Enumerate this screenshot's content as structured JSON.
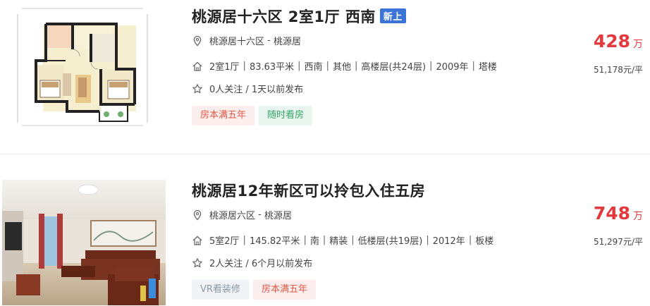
{
  "listings": [
    {
      "title": "桃源居十六区 2室1厅 西南",
      "badge": "新上",
      "community": "桃源居十六区",
      "region": "桃源居",
      "location_sep": " - ",
      "info": [
        "2室1厅",
        "83.63平米",
        "西南",
        "其他",
        "高楼层(共24层)",
        "2009年",
        "塔楼"
      ],
      "follow": "0人关注 / 1天以前发布",
      "tags": [
        "房本满五年",
        "随时看房"
      ],
      "price": "428",
      "price_unit": "万",
      "unit_price": "51,178元/平",
      "thumbnail": "floor-plan"
    },
    {
      "title": "桃源居12年新区可以拎包入住五房",
      "community": "桃源居六区",
      "region": "桃源居",
      "location_sep": " - ",
      "info": [
        "5室2厅",
        "145.82平米",
        "南",
        "精装",
        "低楼层(共19层)",
        "2012年",
        "板楼"
      ],
      "follow": "2人关注 / 6个月以前发布",
      "tags": [
        "VR看装修",
        "房本满五年"
      ],
      "price": "748",
      "price_unit": "万",
      "unit_price": "51,297元/平",
      "thumbnail": "living-room-photo"
    }
  ],
  "info_separator": "|",
  "icons": {
    "location": "map-pin-icon",
    "house": "house-icon",
    "star": "star-icon"
  },
  "colors": {
    "price": "#e4393c",
    "badge_new": "#3b74d6",
    "tag_red_text": "#e4584a",
    "tag_green_text": "#36a467",
    "tag_gray_text": "#8a98a8"
  }
}
